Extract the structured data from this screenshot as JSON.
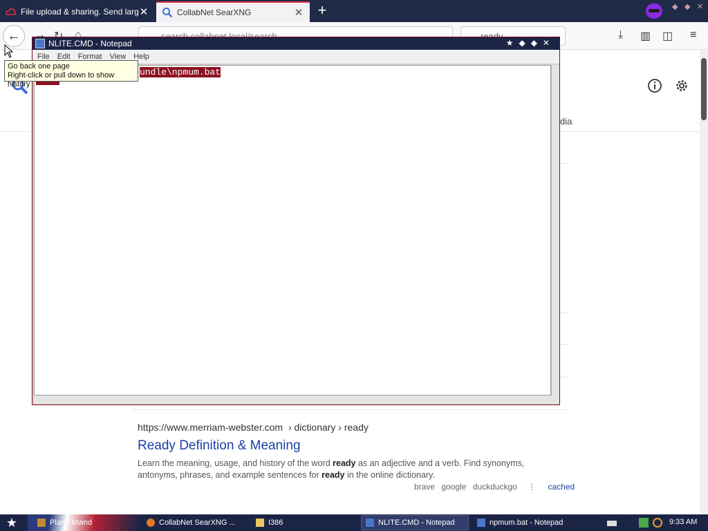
{
  "browser": {
    "tabs": [
      {
        "title": "File upload & sharing. Send large p",
        "active": false,
        "icon": "cloud-icon"
      },
      {
        "title": "CollabNet SearXNG",
        "active": true,
        "icon": "search-icon"
      }
    ],
    "new_tab_label": "+",
    "url": "search.collabnet.local/search",
    "search_box": "ready",
    "back_tooltip": {
      "line1": "Go back one page",
      "line2": "Right-click or pull down to show history"
    }
  },
  "page": {
    "category_tail": "dia",
    "result": {
      "url": "https://www.merriam-webster.com",
      "breadcrumb": "› dictionary › ready",
      "title": "Ready Definition & Meaning",
      "snippet_parts": {
        "a": "Learn the meaning, usage, and history of the word ",
        "b": "ready",
        "c": " as an adjective and a verb. Find synonyms, antonyms, phrases, and example sentences for ",
        "d": "ready",
        "e": " in the online dictionary."
      },
      "engines": [
        "brave",
        "google",
        "duckduckgo"
      ],
      "menu_glyph": "⋮",
      "cached": "cached"
    }
  },
  "notepad": {
    "title": "NLITE.CMD - Notepad",
    "menu": [
      "File",
      "Edit",
      "Format",
      "View",
      "Help"
    ],
    "content_visible": "undle\\npmum.bat"
  },
  "taskbar": {
    "items": [
      {
        "label": "Plan - Mwnd"
      },
      {
        "label": "CollabNet SearXNG ..."
      },
      {
        "label": "I386"
      },
      {
        "label": "NLITE.CMD - Notepad",
        "active": true
      },
      {
        "label": "npmum.bat - Notepad"
      }
    ],
    "clock": "9:33 AM"
  },
  "colors": {
    "tabstrip": "#1f2a47",
    "accent_red": "#8b1220",
    "link_blue": "#1a3fa8",
    "taskbar": "#1c2446"
  }
}
